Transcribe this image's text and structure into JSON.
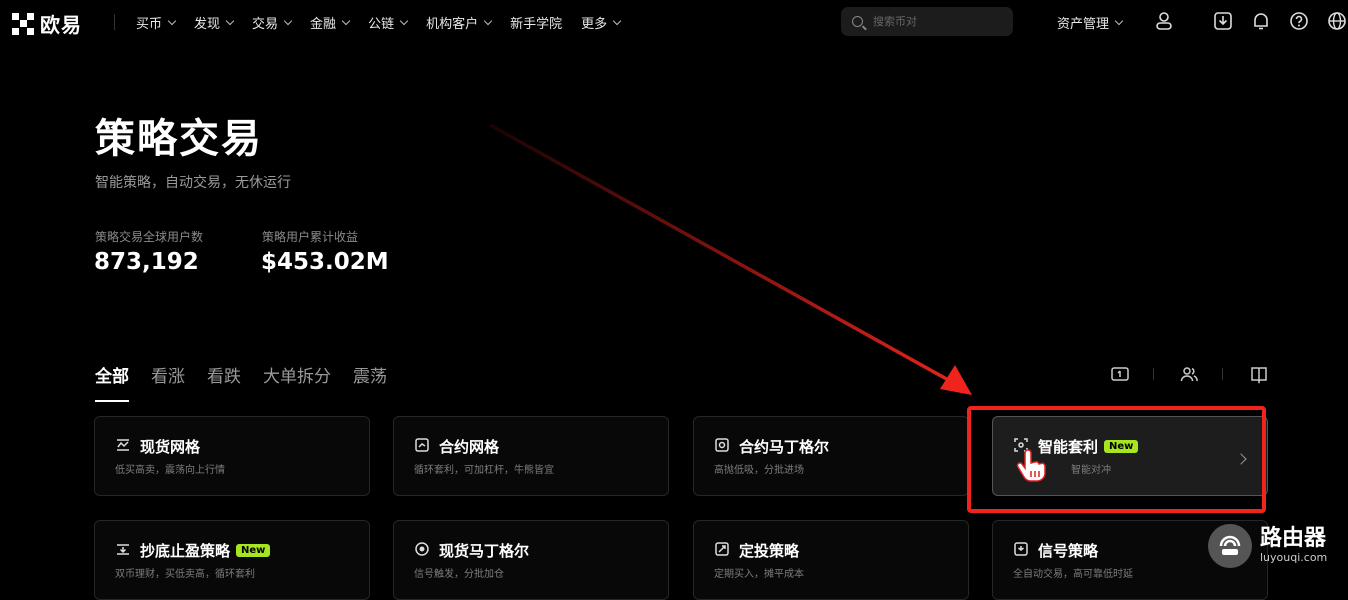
{
  "nav": {
    "logo_text": "欧易",
    "menu": [
      {
        "label": "买币",
        "has_dropdown": true
      },
      {
        "label": "发现",
        "has_dropdown": true
      },
      {
        "label": "交易",
        "has_dropdown": true
      },
      {
        "label": "金融",
        "has_dropdown": true
      },
      {
        "label": "公链",
        "has_dropdown": true
      },
      {
        "label": "机构客户",
        "has_dropdown": true
      },
      {
        "label": "新手学院",
        "has_dropdown": false
      },
      {
        "label": "更多",
        "has_dropdown": true
      }
    ],
    "search_placeholder": "搜索币对",
    "assets_label": "资产管理",
    "icons": [
      "user-icon",
      "download-icon",
      "bell-icon",
      "help-icon",
      "globe-icon"
    ]
  },
  "hero": {
    "title": "策略交易",
    "subtitle": "智能策略，自动交易，无休运行",
    "stats": [
      {
        "label": "策略交易全球用户数",
        "value": "873,192"
      },
      {
        "label": "策略用户累计收益",
        "value": "$453.02M"
      }
    ]
  },
  "tabs": [
    {
      "label": "全部",
      "active": true
    },
    {
      "label": "看涨",
      "active": false
    },
    {
      "label": "看跌",
      "active": false
    },
    {
      "label": "大单拆分",
      "active": false
    },
    {
      "label": "震荡",
      "active": false
    }
  ],
  "view_icons": [
    "card-view-icon",
    "community-icon",
    "guide-book-icon"
  ],
  "cards": [
    {
      "title": "现货网格",
      "desc": "低买高卖，震荡向上行情",
      "badge": "",
      "icon": "spot-grid-icon"
    },
    {
      "title": "合约网格",
      "desc": "循环套利，可加杠杆，牛熊皆宜",
      "badge": "",
      "icon": "contract-grid-icon"
    },
    {
      "title": "合约马丁格尔",
      "desc": "高抛低吸，分批进场",
      "badge": "",
      "icon": "contract-martingale-icon"
    },
    {
      "title": "智能套利",
      "desc": "智能对冲",
      "badge": "New",
      "icon": "smart-arbitrage-icon"
    },
    {
      "title": "抄底止盈策略",
      "desc": "双币理财，买低卖高，循环套利",
      "badge": "New",
      "icon": "buy-dip-icon"
    },
    {
      "title": "现货马丁格尔",
      "desc": "信号触发，分批加仓",
      "badge": "",
      "icon": "spot-martingale-icon"
    },
    {
      "title": "定投策略",
      "desc": "定期买入，摊平成本",
      "badge": "",
      "icon": "recurring-buy-icon"
    },
    {
      "title": "信号策略",
      "desc": "全自动交易，高可靠低时延",
      "badge": "",
      "icon": "signal-icon"
    }
  ],
  "watermark": {
    "title": "路由器",
    "url": "luyouqi.com"
  },
  "colors": {
    "accent_green": "#a7e520",
    "annotation_red": "#f0241c",
    "background": "#000000"
  }
}
